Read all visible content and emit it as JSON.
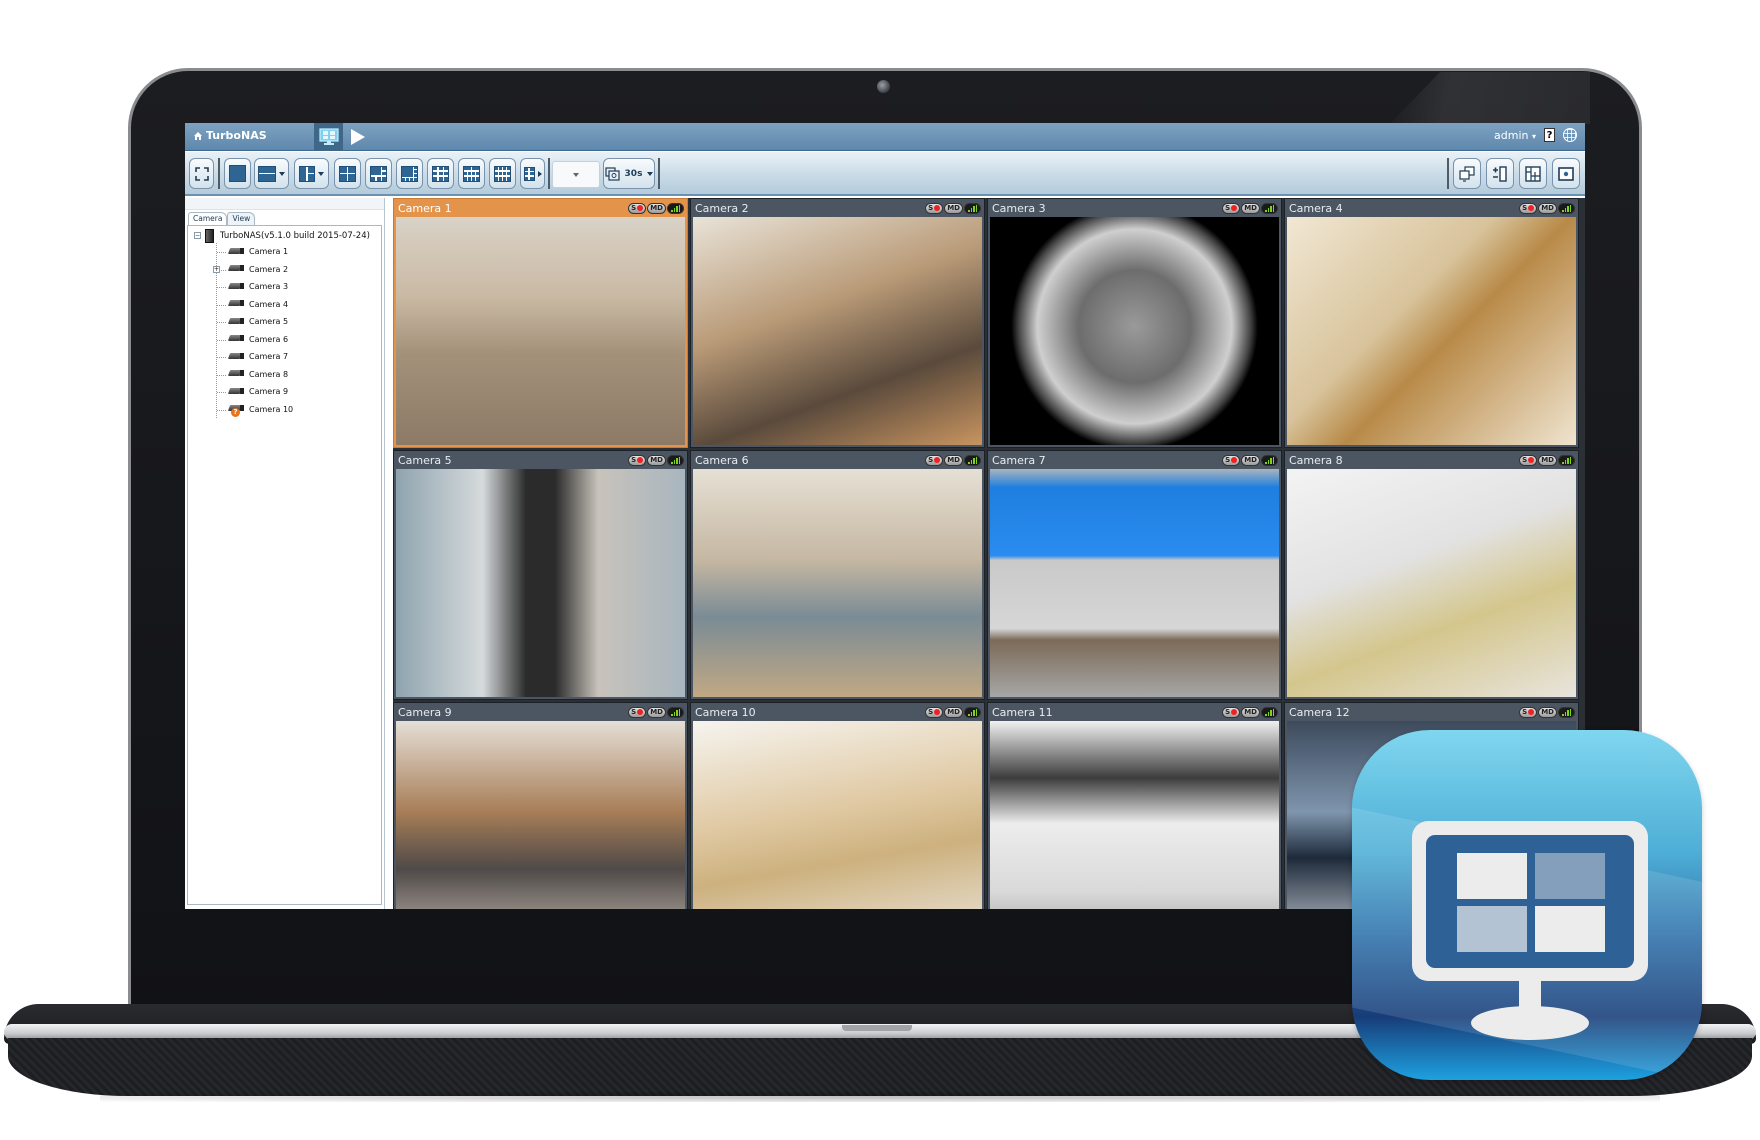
{
  "app": {
    "brand": "TurboNAS",
    "user": "admin",
    "help_label": "?",
    "sequence_interval": "30s",
    "dropdown_value": ""
  },
  "toolbar": {
    "left_buttons": [
      {
        "name": "fullscreen-button",
        "icon": "fullscreen-icon"
      },
      {
        "name": "layout-1-button",
        "icon": "layout-1x1-icon"
      },
      {
        "name": "layout-2-button",
        "icon": "layout-2-rows-icon",
        "has_menu": true
      },
      {
        "name": "layout-3-button",
        "icon": "layout-3-split-icon",
        "has_menu": true
      },
      {
        "name": "layout-4-button",
        "icon": "layout-2x2-icon"
      },
      {
        "name": "layout-6-button",
        "icon": "layout-6-icon"
      },
      {
        "name": "layout-8-button",
        "icon": "layout-8-icon"
      },
      {
        "name": "layout-9-button",
        "icon": "layout-3x3-icon"
      },
      {
        "name": "layout-10-button",
        "icon": "layout-10-icon"
      },
      {
        "name": "layout-12-button",
        "icon": "layout-12-icon"
      },
      {
        "name": "layout-more-button",
        "icon": "layout-more-icon"
      }
    ],
    "right_buttons": [
      {
        "name": "multi-monitor-button",
        "icon": "multi-monitor-icon"
      },
      {
        "name": "add-remove-channel-button",
        "icon": "add-remove-icon"
      },
      {
        "name": "custom-layout-button",
        "icon": "custom-layout-icon"
      },
      {
        "name": "settings-button",
        "icon": "settings-icon"
      }
    ]
  },
  "sidebar": {
    "tabs": [
      "Camera",
      "View"
    ],
    "active_tab": "Camera",
    "root": "TurboNAS(v5.1.0 build 2015-07-24)",
    "cameras": [
      {
        "label": "Camera 1",
        "status": "ok"
      },
      {
        "label": "Camera 2",
        "status": "ok",
        "expandable": true
      },
      {
        "label": "Camera 3",
        "status": "ok"
      },
      {
        "label": "Camera 4",
        "status": "ok"
      },
      {
        "label": "Camera 5",
        "status": "ok"
      },
      {
        "label": "Camera 6",
        "status": "ok"
      },
      {
        "label": "Camera 7",
        "status": "ok"
      },
      {
        "label": "Camera 8",
        "status": "ok"
      },
      {
        "label": "Camera 9",
        "status": "ok"
      },
      {
        "label": "Camera 10",
        "status": "unknown"
      }
    ]
  },
  "grid": {
    "badges": {
      "schedule": "S",
      "motion": "MD"
    },
    "colors": {
      "selected": "#e4944a",
      "tile": "#4c5663",
      "signal": "#7ed321",
      "rec": "#ee2222"
    },
    "tiles": [
      {
        "label": "Camera 1",
        "selected": true,
        "scene": "lobby"
      },
      {
        "label": "Camera 2",
        "selected": false,
        "scene": "office"
      },
      {
        "label": "Camera 3",
        "selected": false,
        "scene": "fisheye"
      },
      {
        "label": "Camera 4",
        "selected": false,
        "scene": "desks-top"
      },
      {
        "label": "Camera 5",
        "selected": false,
        "scene": "atrium"
      },
      {
        "label": "Camera 6",
        "selected": false,
        "scene": "cubicles"
      },
      {
        "label": "Camera 7",
        "selected": false,
        "scene": "parking"
      },
      {
        "label": "Camera 8",
        "selected": false,
        "scene": "lounge"
      },
      {
        "label": "Camera 9",
        "selected": false,
        "scene": "workshop"
      },
      {
        "label": "Camera 10",
        "selected": false,
        "scene": "lobby-sofa"
      },
      {
        "label": "Camera 11",
        "selected": false,
        "scene": "hallway"
      },
      {
        "label": "Camera 12",
        "selected": false,
        "scene": "departures"
      }
    ]
  },
  "app_icon": {
    "name": "VMobile-desktop-icon",
    "colors": {
      "top": "#7fd6ef",
      "bottom": "#173d79"
    }
  }
}
